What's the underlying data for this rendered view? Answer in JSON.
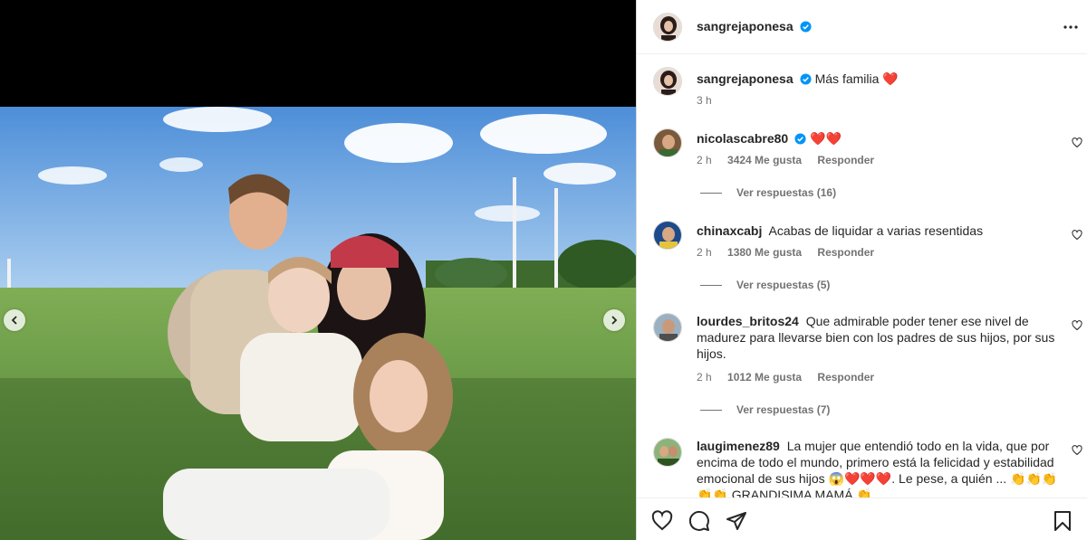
{
  "post": {
    "author": "sangrejaponesa",
    "caption": "Más familia",
    "caption_emoji": "❤️",
    "time": "3 h"
  },
  "media": {
    "prev_icon": "chevron-left-icon",
    "next_icon": "chevron-right-icon"
  },
  "comments": [
    {
      "username": "nicolascabre80",
      "text": "❤️❤️",
      "time": "2 h",
      "likes": "3424 Me gusta",
      "reply": "Responder",
      "replies": "Ver respuestas (16)"
    },
    {
      "username": "chinaxcabj",
      "text": "Acabas de liquidar a varias resentidas",
      "time": "2 h",
      "likes": "1380 Me gusta",
      "reply": "Responder",
      "replies": "Ver respuestas (5)"
    },
    {
      "username": "lourdes_britos24",
      "text": "Que admirable poder tener ese nivel de madurez para llevarse bien con los padres de sus hijos, por sus hijos.",
      "time": "2 h",
      "likes": "1012 Me gusta",
      "reply": "Responder",
      "replies": "Ver respuestas (7)"
    },
    {
      "username": "laugimenez89",
      "text": "La mujer que entendió todo en la vida, que por encima de todo el mundo, primero está la felicidad y estabilidad emocional de sus hijos 😱❤️❤️❤️. Le pese,",
      "text_cut": "a quién ... 👏👏👏👏👏 GRANDISIMA MAMÁ 👏"
    }
  ],
  "actions": [
    "heart-icon",
    "comment-icon",
    "share-icon",
    "bookmark-icon"
  ],
  "colors": {
    "verified": "#0095f6",
    "heart_red": "#ed4956",
    "muted": "#737373"
  }
}
